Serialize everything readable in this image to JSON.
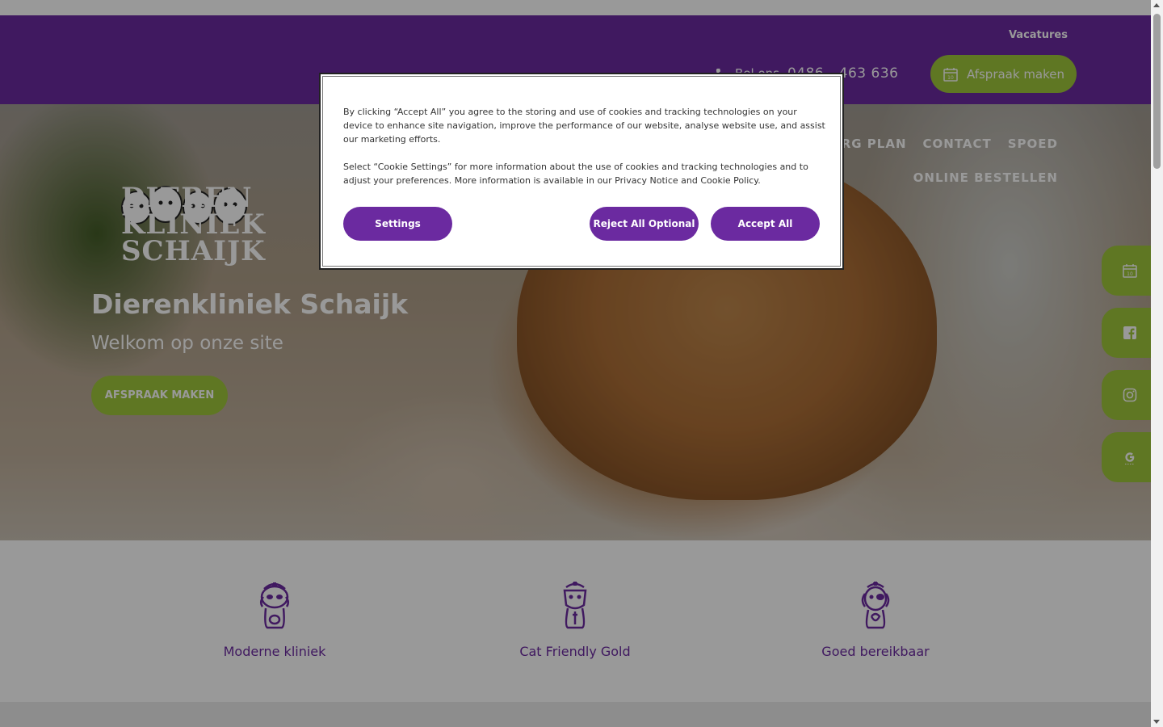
{
  "header": {
    "top_link": "Vacatures",
    "phone_label": "Bel ons",
    "phone_number": "0486 - 463 636",
    "cta_label": "Afspraak maken"
  },
  "nav": {
    "row1": [
      "ZORG PLAN",
      "CONTACT",
      "SPOED"
    ],
    "row2": [
      "ONLINE BESTELLEN"
    ]
  },
  "logo": {
    "lines": [
      "DIEREN",
      "KLINIEK",
      "SCHAIJK"
    ]
  },
  "hero": {
    "title": "Dierenkliniek Schaijk",
    "subtitle": "Welkom op onze site",
    "button": "AFSPRAAK MAKEN"
  },
  "side_tabs": [
    "calendar-icon",
    "facebook-icon",
    "instagram-icon",
    "google-icon"
  ],
  "features": [
    {
      "icon": "dog-nurse-icon",
      "label": "Moderne kliniek"
    },
    {
      "icon": "cat-nurse-icon",
      "label": "Cat Friendly Gold"
    },
    {
      "icon": "dog-doctor-icon",
      "label": "Goed bereikbaar"
    }
  ],
  "cookie": {
    "paragraph1": "By clicking “Accept All” you agree to the storing and use of cookies and tracking technologies on your device to enhance site navigation, improve the performance of our website, analyse website use, and assist our marketing efforts.",
    "paragraph2": "Select “Cookie Settings” for more information about the use of cookies and tracking technologies and to adjust your preferences. More information is available in our Privacy Notice and Cookie Policy.",
    "settings_label": "Settings",
    "reject_label": "Reject All Optional",
    "accept_label": "Accept All"
  },
  "colors": {
    "brand_purple": "#6b2aa0",
    "accent_green": "#9ec63b",
    "overlay": "rgba(0,0,0,0.4)"
  }
}
